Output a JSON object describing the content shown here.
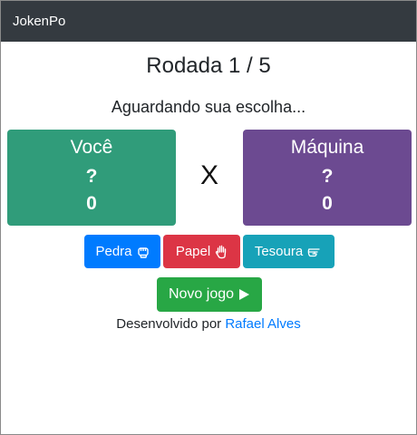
{
  "app": {
    "brand": "JokenPo"
  },
  "header": {
    "round_title": "Rodada 1 / 5",
    "status": "Aguardando sua escolha..."
  },
  "player": {
    "name": "Você",
    "choice": "?",
    "score": "0",
    "color": "#309c7a"
  },
  "versus": "X",
  "computer": {
    "name": "Máquina",
    "choice": "?",
    "score": "0",
    "color": "#6c4a91"
  },
  "choices": [
    {
      "label": "Pedra",
      "icon": "hand-rock-icon",
      "color": "#007bff"
    },
    {
      "label": "Papel",
      "icon": "hand-paper-icon",
      "color": "#dc3545"
    },
    {
      "label": "Tesoura",
      "icon": "hand-scissors-icon",
      "color": "#17a2b8"
    }
  ],
  "new_game": {
    "label": "Novo jogo",
    "icon": "play-icon",
    "color": "#28a745"
  },
  "footer": {
    "prefix": "Desenvolvido por",
    "author": "Rafael Alves"
  }
}
